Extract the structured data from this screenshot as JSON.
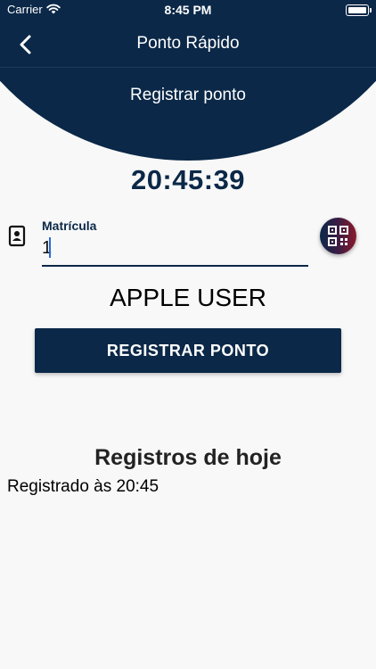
{
  "status_bar": {
    "carrier": "Carrier",
    "time": "8:45 PM",
    "wifi_icon": "wifi-icon",
    "battery_icon": "battery-icon"
  },
  "nav": {
    "title": "Ponto Rápido",
    "back_icon": "chevron-left-icon"
  },
  "header": {
    "subtitle": "Registrar ponto",
    "color": "#0b2848"
  },
  "clock": {
    "time": "20:45:39"
  },
  "form": {
    "matricula_label": "Matrícula",
    "matricula_value": "1",
    "badge_icon": "id-badge-icon",
    "qr_icon": "qr-code-icon"
  },
  "user": {
    "name": "APPLE USER"
  },
  "actions": {
    "register_label": "REGISTRAR PONTO"
  },
  "records": {
    "title": "Registros de hoje",
    "items": [
      "Registrado às 20:45"
    ]
  },
  "colors": {
    "primary": "#0b2848",
    "accent": "#8b1a2a",
    "background": "#f8f8f8"
  }
}
